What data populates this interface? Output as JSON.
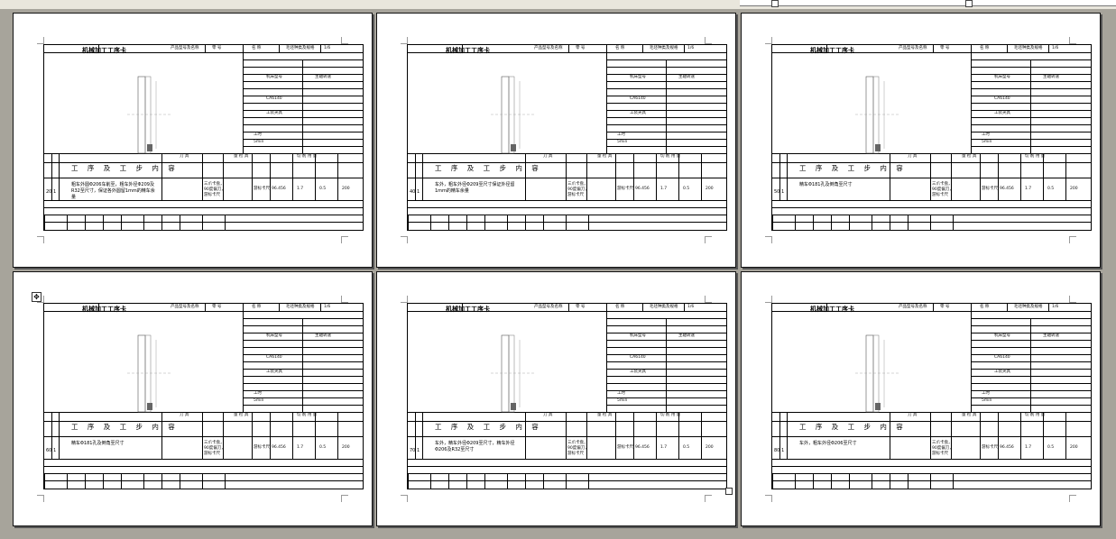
{
  "window": {
    "title": "机械加工工序卡"
  },
  "ruler": {
    "visible": true
  },
  "pages": [
    {
      "title": "机械加工工序卡",
      "proc_no": "20",
      "step": "1",
      "desc": "粗车外圆Φ206车削至，粗车外径Φ209及R32至尺寸，保证各外圆留1mm的精车余量"
    },
    {
      "title": "机械加工工序卡",
      "proc_no": "40",
      "step": "1",
      "desc": "车外，粗车外径Φ209至尺寸保证外径留1mm的精车余量"
    },
    {
      "title": "机械加工工序卡",
      "proc_no": "50",
      "step": "1",
      "desc": "精车Φ181孔及倒角至尺寸"
    },
    {
      "title": "机械加工工序卡",
      "proc_no": "60",
      "step": "1",
      "desc": "精车Φ181孔及倒角至尺寸"
    },
    {
      "title": "机械加工工序卡",
      "proc_no": "70",
      "step": "1",
      "desc": "车外，精车外径Φ209至尺寸，精车外径Φ206及R32至尺寸"
    },
    {
      "title": "机械加工工序卡",
      "proc_no": "80",
      "step": "1",
      "desc": "车外，粗车外径Φ206至尺寸"
    }
  ],
  "header_labels": {
    "product": "产品型号及名称",
    "part_no": "零 号",
    "part_name": "名 称",
    "material": "毛坯种类及规格",
    "page": "1/6",
    "process_content": "工 序 及 工 步 内 容",
    "tool": "刀 具",
    "measure": "量 检 具",
    "params": "切 削 用 量",
    "fixture": "工装夹具",
    "machine": "机床型号",
    "spindle": "主轴转速",
    "time": "工时",
    "clamp": "三爪卡盘，90度偏刀，游标卡尺",
    "gauge": "游标卡尺",
    "speed": "96.456",
    "feed": "1.7",
    "depth": "0.5",
    "rpm": "200",
    "ca": "CA6140",
    "min": "5min"
  }
}
